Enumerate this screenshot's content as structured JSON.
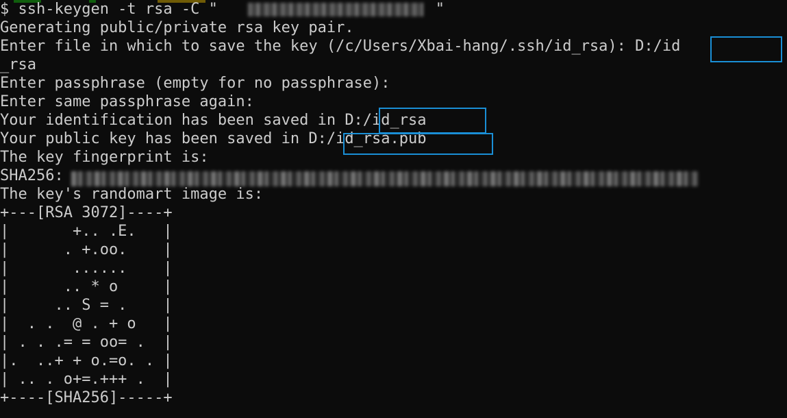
{
  "terminal": {
    "background_color": "#0c0c0c",
    "text_color": "#cccccc",
    "highlight_color": "#1a8fd6",
    "lines": [
      "$ ssh-keygen -t rsa -C \"                        \"",
      "Generating public/private rsa key pair.",
      "Enter file in which to save the key (/c/Users/Xbai-hang/.ssh/id_rsa): D:/id",
      "_rsa",
      "Enter passphrase (empty for no passphrase):",
      "Enter same passphrase again:",
      "Your identification has been saved in D:/id_rsa",
      "Your public key has been saved in D:/id_rsa.pub",
      "The key fingerprint is:",
      "SHA256:",
      "The key's randomart image is:",
      "+---[RSA 3072]----+",
      "|       +.. .E.   |",
      "|      . +.oo.    |",
      "|       ......    |",
      "|      .. * o     |",
      "|     .. S = .    |",
      "|  . .  @ . + o   |",
      "| . . .= = oo= .  |",
      "|.  ..+ + o.=o. . |",
      "| .. . o+=.+++ .  |",
      "+----[SHA256]-----+"
    ]
  }
}
